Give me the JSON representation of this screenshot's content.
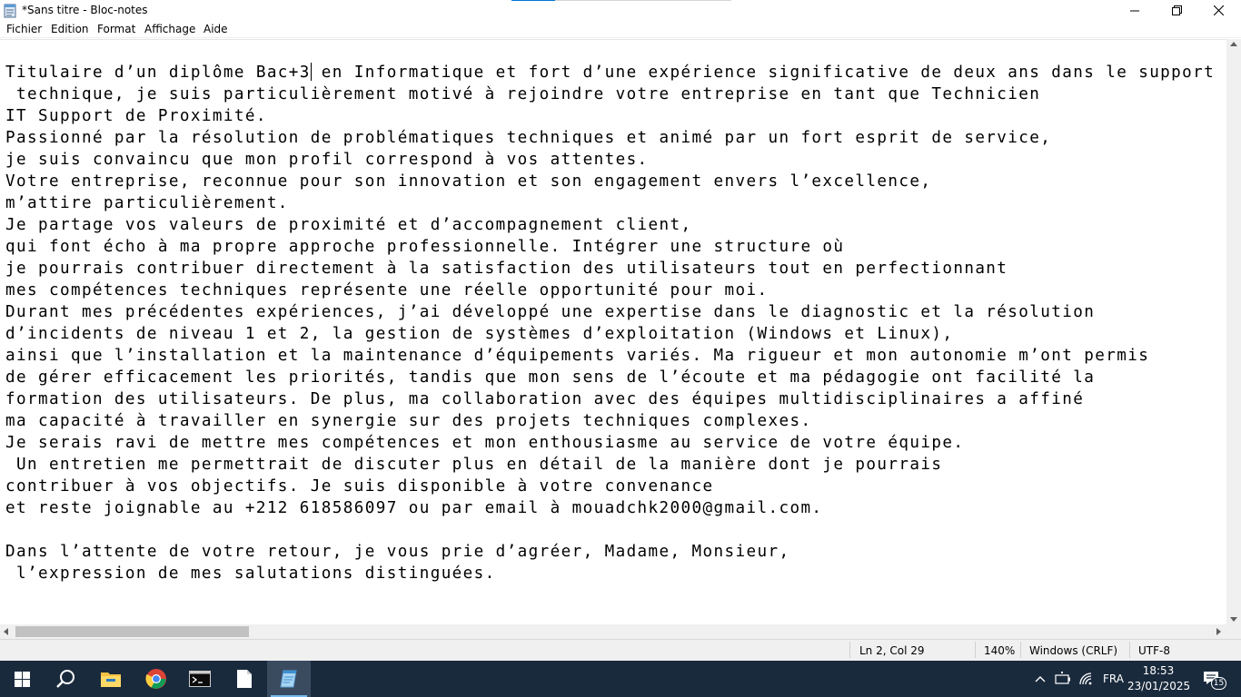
{
  "window": {
    "title": "*Sans titre - Bloc-notes"
  },
  "menu": {
    "items": [
      "Fichier",
      "Edition",
      "Format",
      "Affichage",
      "Aide"
    ]
  },
  "editor": {
    "lines": [
      "Titulaire d’un diplôme Bac+3 en Informatique et fort d’une expérience significative de deux ans dans le support",
      " technique, je suis particulièrement motivé à rejoindre votre entreprise en tant que Technicien",
      "IT Support de Proximité.",
      "Passionné par la résolution de problématiques techniques et animé par un fort esprit de service,",
      "je suis convaincu que mon profil correspond à vos attentes.",
      "Votre entreprise, reconnue pour son innovation et son engagement envers l’excellence,",
      "m’attire particulièrement.",
      "Je partage vos valeurs de proximité et d’accompagnement client,",
      "qui font écho à ma propre approche professionnelle. Intégrer une structure où",
      "je pourrais contribuer directement à la satisfaction des utilisateurs tout en perfectionnant",
      "mes compétences techniques représente une réelle opportunité pour moi.",
      "Durant mes précédentes expériences, j’ai développé une expertise dans le diagnostic et la résolution",
      "d’incidents de niveau 1 et 2, la gestion de systèmes d’exploitation (Windows et Linux),",
      "ainsi que l’installation et la maintenance d’équipements variés. Ma rigueur et mon autonomie m’ont permis",
      "de gérer efficacement les priorités, tandis que mon sens de l’écoute et ma pédagogie ont facilité la",
      "formation des utilisateurs. De plus, ma collaboration avec des équipes multidisciplinaires a affiné",
      "ma capacité à travailler en synergie sur des projets techniques complexes.",
      "Je serais ravi de mettre mes compétences et mon enthousiasme au service de votre équipe.",
      " Un entretien me permettrait de discuter plus en détail de la manière dont je pourrais",
      "contribuer à vos objectifs. Je suis disponible à votre convenance",
      "et reste joignable au +212 618586097 ou par email à mouadchk2000@gmail.com.",
      "",
      "Dans l’attente de votre retour, je vous prie d’agréer, Madame, Monsieur,",
      " l’expression de mes salutations distinguées."
    ]
  },
  "status": {
    "position": "Ln 2, Col 29",
    "zoom": "140%",
    "line_ending": "Windows (CRLF)",
    "encoding": "UTF-8"
  },
  "taskbar": {
    "language": "FRA",
    "time": "18:53",
    "date": "23/01/2025",
    "notification_count": "15",
    "apps": [
      "start-icon",
      "search-icon",
      "file-explorer-icon",
      "chrome-icon",
      "terminal-icon",
      "notepad-doc-icon",
      "notepad-active-icon"
    ]
  },
  "colors": {
    "taskbar_bg": "#1a2a3d",
    "accent": "#0078d7"
  }
}
